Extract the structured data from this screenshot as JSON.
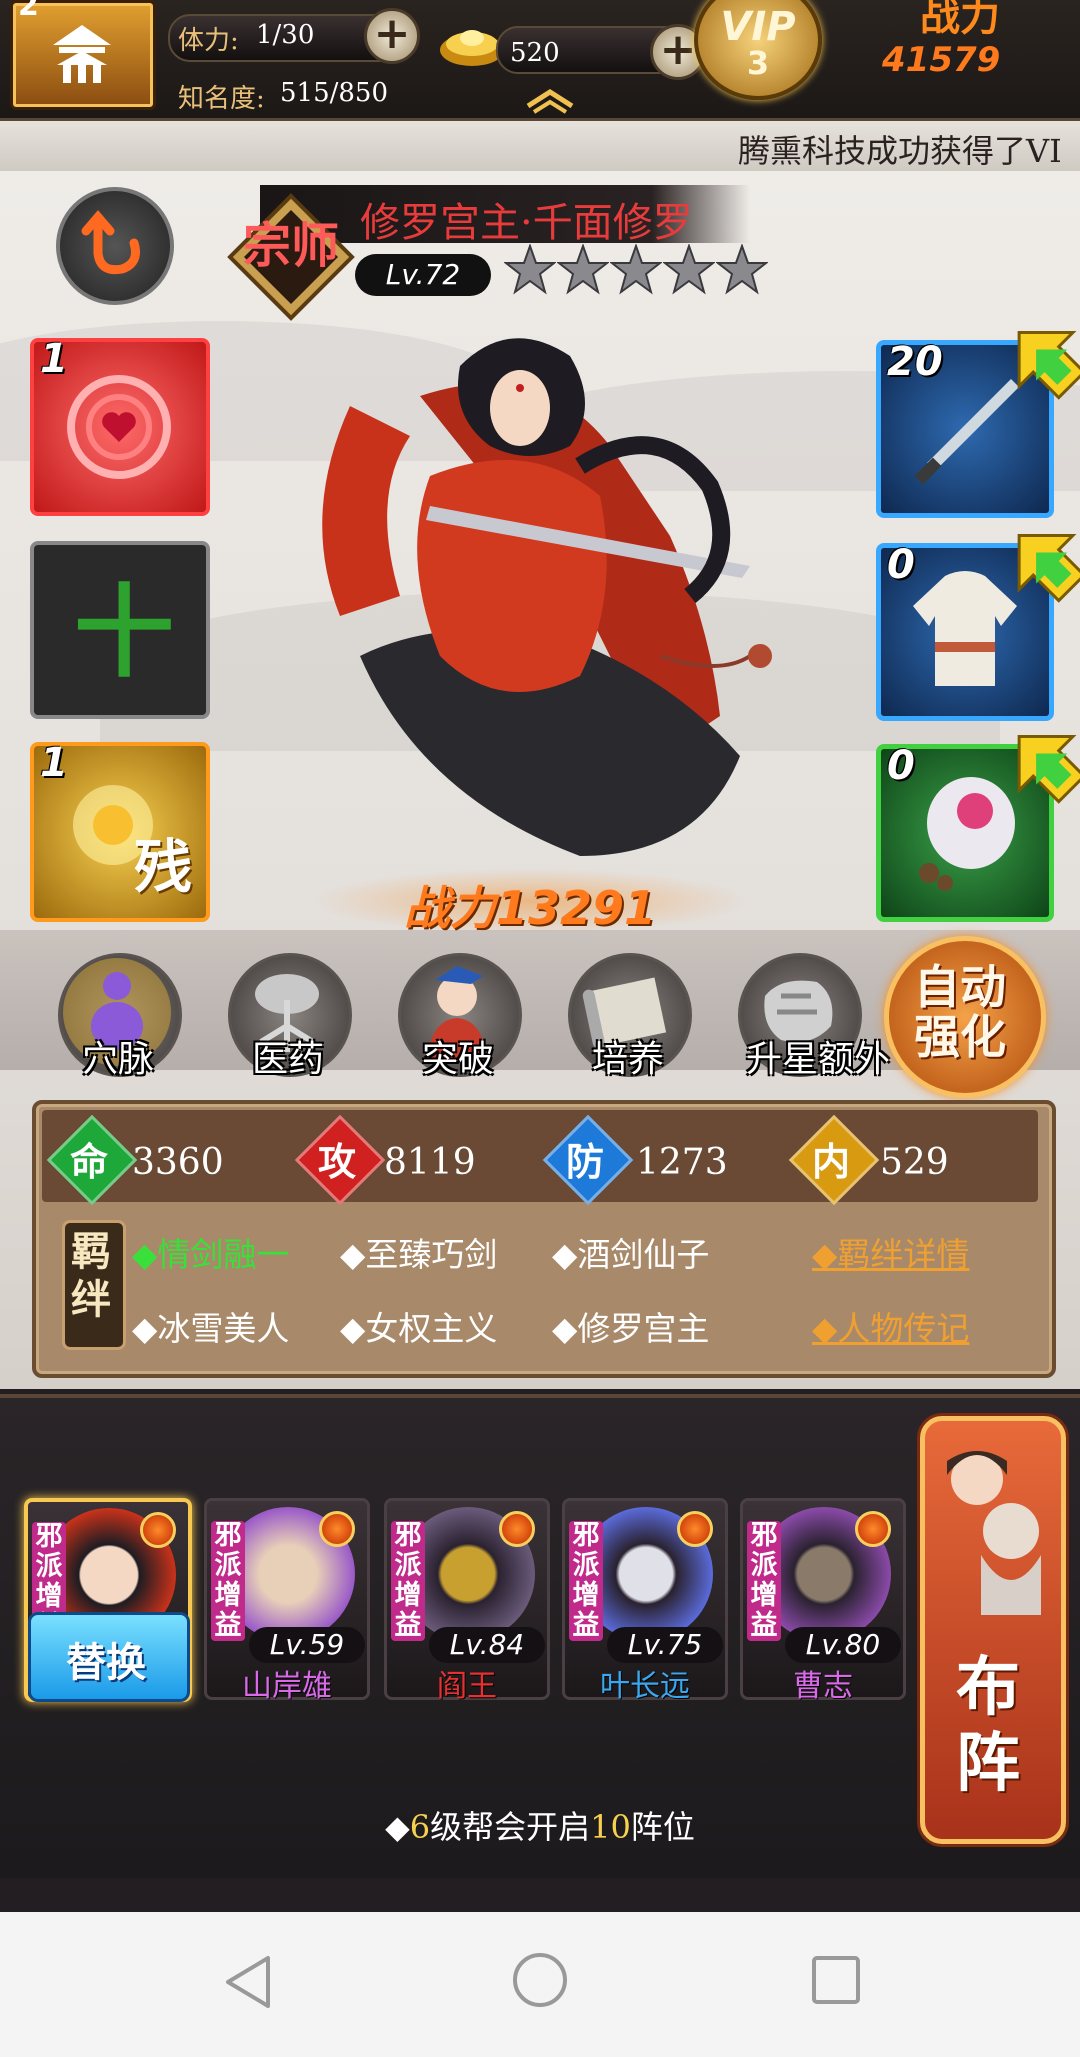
{
  "top_bar": {
    "home_level": "2",
    "stamina_label": "体力:",
    "stamina_value": "1/30",
    "fame_label": "知名度:",
    "fame_value": "515/850",
    "gold_value": "520",
    "vip_label": "VIP",
    "vip_level": "3",
    "power_label": "战力",
    "power_value": "41579"
  },
  "notice": {
    "text": "腾熏科技成功获得了VI"
  },
  "hero": {
    "rank": "宗师",
    "name": "修罗宫主·千面修罗",
    "level": "Lv.72",
    "stars": 5,
    "power_text": "战力13291",
    "left_slots": [
      {
        "count": "1",
        "icon": "heart-swirl-icon"
      },
      {
        "count": "",
        "icon": "plus-icon",
        "plus": "十"
      },
      {
        "count": "1",
        "icon": "golden-flower-icon",
        "tag": "残"
      }
    ],
    "right_slots": [
      {
        "count": "20",
        "icon": "dagger-icon"
      },
      {
        "count": "0",
        "icon": "robe-icon"
      },
      {
        "count": "0",
        "icon": "flower-pouch-icon"
      }
    ]
  },
  "functions": [
    "穴脉",
    "医药",
    "突破",
    "培养",
    "升星额外"
  ],
  "auto_button": {
    "line1": "自动",
    "line2": "强化"
  },
  "stats": [
    {
      "char": "命",
      "value": "3360",
      "color": "#1ea83a"
    },
    {
      "char": "攻",
      "value": "8119",
      "color": "#d02020"
    },
    {
      "char": "防",
      "value": "1273",
      "color": "#1e7ad8"
    },
    {
      "char": "内",
      "value": "529",
      "color": "#d89a10"
    }
  ],
  "bonds": {
    "tag": "羁绊",
    "items": [
      {
        "text": "◆情剑融一",
        "active": true
      },
      {
        "text": "◆至臻巧剑",
        "active": false
      },
      {
        "text": "◆酒剑仙子",
        "active": false
      },
      {
        "text": "◆冰雪美人",
        "active": false
      },
      {
        "text": "◆女权主义",
        "active": false
      },
      {
        "text": "◆修罗宫主",
        "active": false
      }
    ],
    "links": [
      "◆羁绊详情",
      "◆人物传记"
    ]
  },
  "lineup": {
    "replace_label": "替换",
    "badge_text": "邪派增益",
    "members": [
      {
        "level": "",
        "name": "",
        "name_color": "#ffffff",
        "portrait": "#c85a3a"
      },
      {
        "level": "Lv.59",
        "name": "山岸雄",
        "name_color": "#d86ae8",
        "portrait": "#9a5ac8"
      },
      {
        "level": "Lv.84",
        "name": "阎王",
        "name_color": "#e83030",
        "portrait": "#6a5a7a"
      },
      {
        "level": "Lv.75",
        "name": "叶长远",
        "name_color": "#3aa8f0",
        "portrait": "#5a6ad8"
      },
      {
        "level": "Lv.80",
        "name": "曹志",
        "name_color": "#d86ae8",
        "portrait": "#8a4aa8"
      }
    ],
    "formation_label": "布阵",
    "hint_prefix": "◆",
    "hint_num1": "6",
    "hint_mid": "级帮会开启",
    "hint_num2": "10",
    "hint_suffix": "阵位"
  },
  "navbar": {
    "icons": [
      "back-icon",
      "home-icon",
      "recents-icon"
    ]
  }
}
